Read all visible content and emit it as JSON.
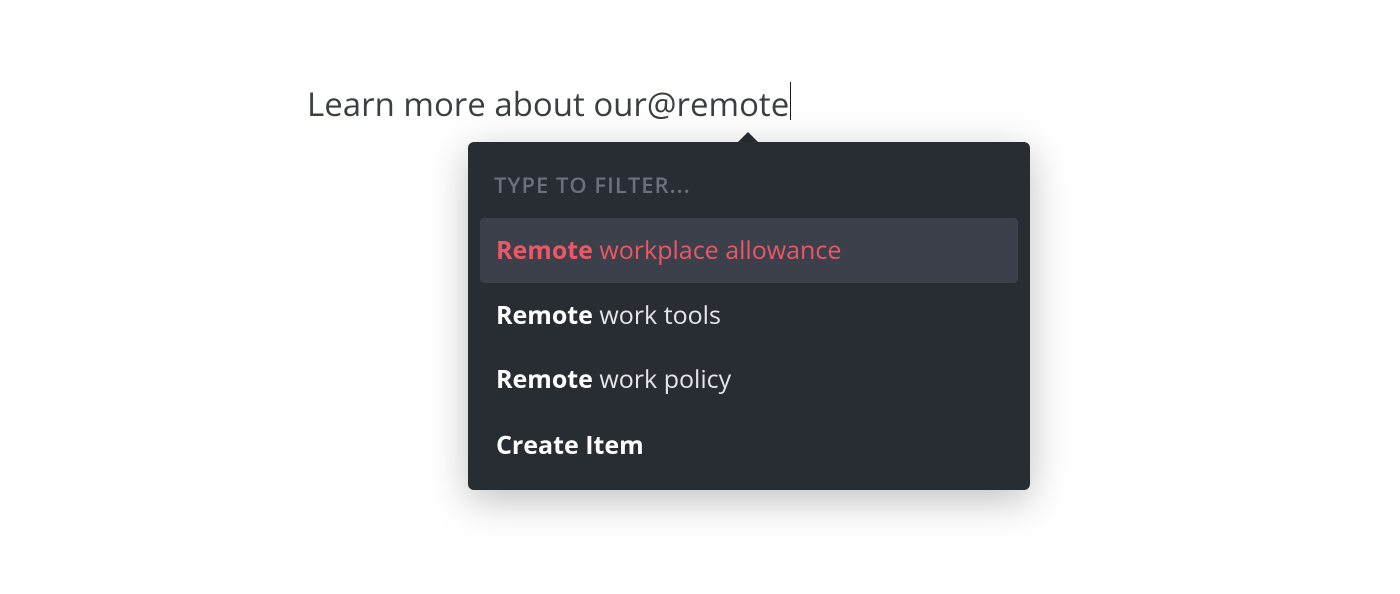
{
  "editor": {
    "text_prefix": "Learn more about our ",
    "mention_text": "@remote"
  },
  "popover": {
    "header": "TYPE TO FILTER...",
    "items": [
      {
        "match": "Remote",
        "rest": " workplace allowance",
        "highlighted": true
      },
      {
        "match": "Remote",
        "rest": " work tools",
        "highlighted": false
      },
      {
        "match": "Remote",
        "rest": " work policy",
        "highlighted": false
      }
    ],
    "action_label": "Create Item"
  }
}
